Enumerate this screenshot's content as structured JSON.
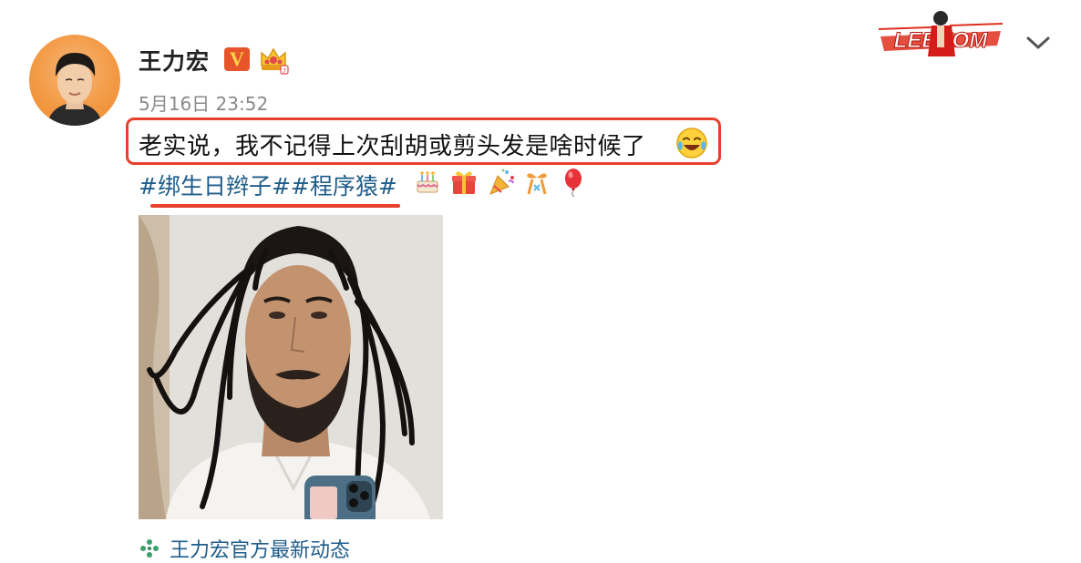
{
  "post": {
    "author": {
      "name": "王力宏",
      "verified_badge": "V"
    },
    "timestamp": "5月16日 23:52",
    "text": "老实说，我不记得上次刮胡或剪头发是啥时候了",
    "text_emoji": "laughing-tears-icon",
    "hashtags": "#绑生日辫子##程序猿#",
    "emojis": [
      "cake-icon",
      "gift-icon",
      "party-popper-icon",
      "ribbon-gift-icon",
      "balloon-icon"
    ],
    "image": "selfie-with-braids-photo",
    "source_label": "王力宏官方最新动态"
  },
  "header_logo": {
    "text": "LEEHOM"
  },
  "colors": {
    "highlight": "#e8402d",
    "link": "#1f5d8a",
    "timestamp": "#8a8a8a",
    "verified": "#e8552b",
    "avatar_bg": "#f39a45"
  }
}
